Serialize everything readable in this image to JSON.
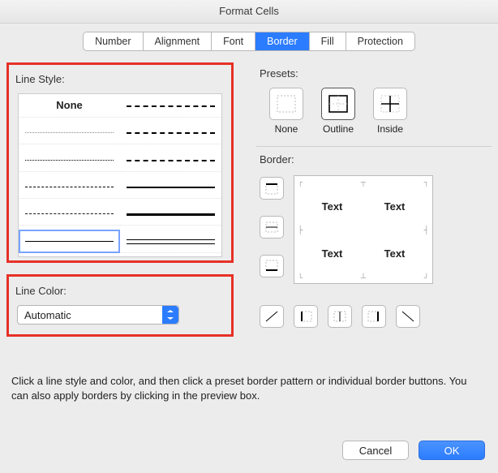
{
  "title": "Format Cells",
  "tabs": [
    "Number",
    "Alignment",
    "Font",
    "Border",
    "Fill",
    "Protection"
  ],
  "active_tab": "Border",
  "left": {
    "line_style_label": "Line Style:",
    "none_label": "None",
    "line_color_label": "Line Color:",
    "color_value": "Automatic"
  },
  "right": {
    "presets_label": "Presets:",
    "preset_items": [
      "None",
      "Outline",
      "Inside"
    ],
    "border_label": "Border:",
    "preview_cells": [
      "Text",
      "Text",
      "Text",
      "Text"
    ]
  },
  "hint": "Click a line style and color, and then click a preset border pattern or individual border buttons. You can also apply borders by clicking in the preview box.",
  "buttons": {
    "cancel": "Cancel",
    "ok": "OK"
  }
}
